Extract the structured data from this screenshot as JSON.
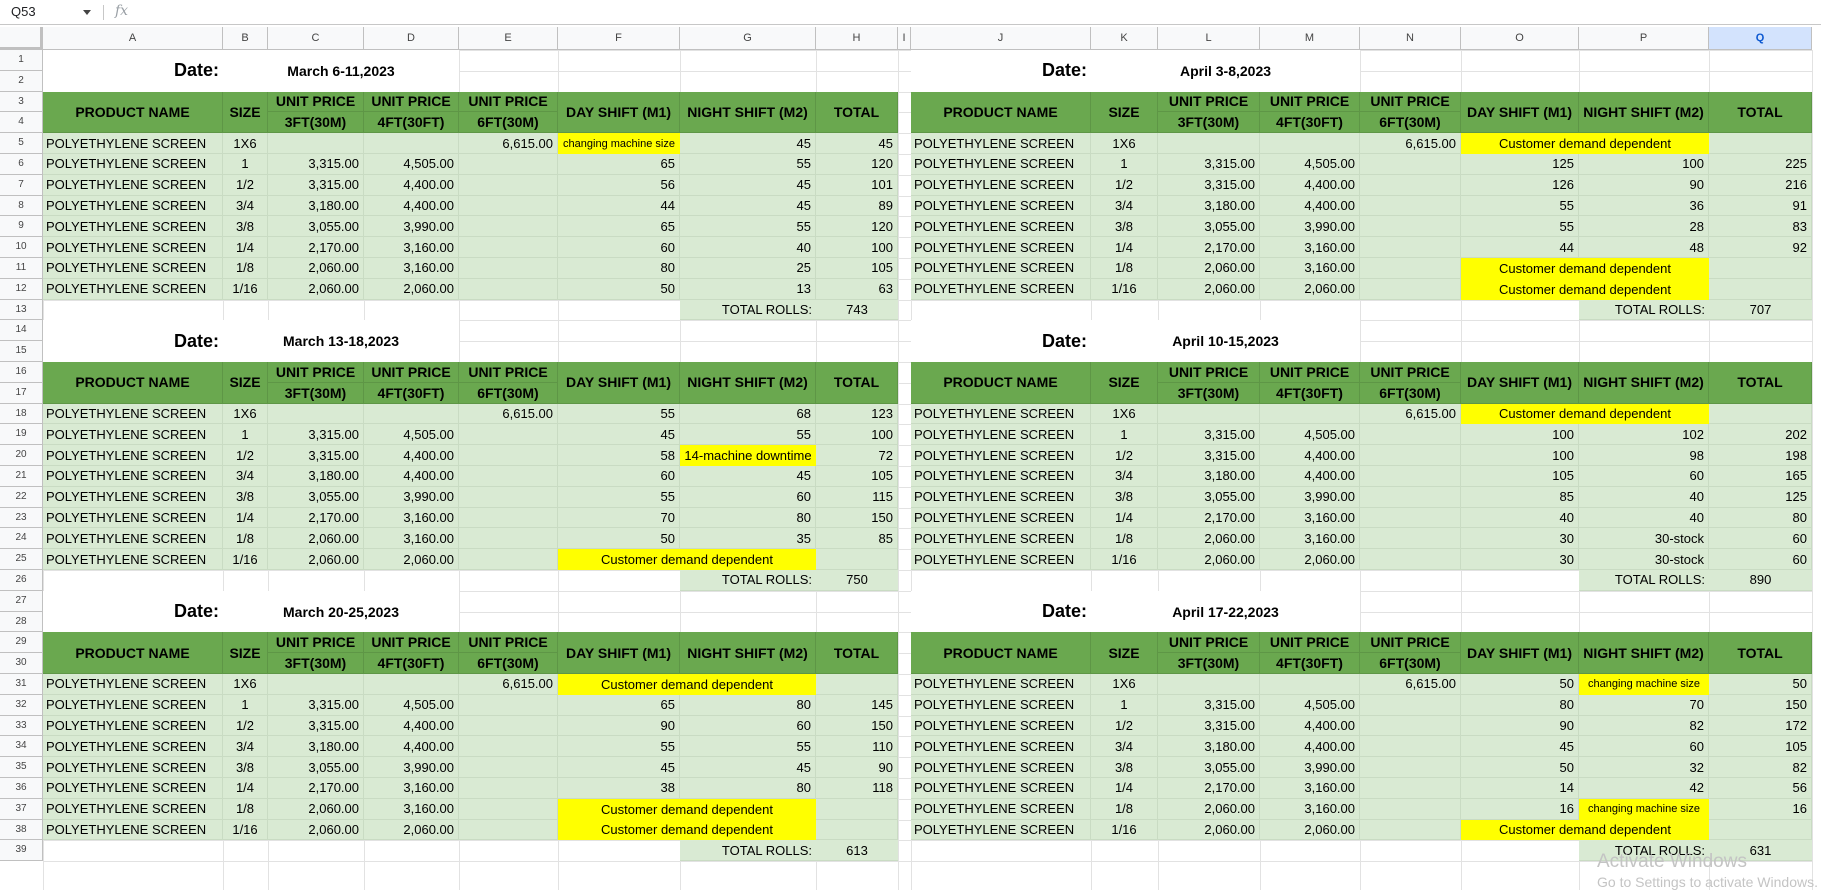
{
  "formula_bar": {
    "name_box": "Q53",
    "fx": "fx"
  },
  "columns": [
    "A",
    "B",
    "C",
    "D",
    "E",
    "F",
    "G",
    "H",
    "I",
    "J",
    "K",
    "L",
    "M",
    "N",
    "O",
    "P",
    "Q"
  ],
  "selected_column": "Q",
  "rows": [
    "1",
    "2",
    "3",
    "4",
    "5",
    "6",
    "7",
    "8",
    "9",
    "10",
    "11",
    "12",
    "13",
    "14",
    "15",
    "16",
    "17",
    "18",
    "19",
    "20",
    "21",
    "22",
    "23",
    "24",
    "25",
    "26",
    "27",
    "28",
    "29",
    "30",
    "31",
    "32",
    "33",
    "34",
    "35",
    "36",
    "37",
    "38",
    "39"
  ],
  "headers": {
    "product": "PRODUCT NAME",
    "size": "SIZE",
    "up": "UNIT PRICE",
    "p3": "3FT(30M)",
    "p4": "4FT(30FT)",
    "p6": "6FT(30M)",
    "day": "DAY SHIFT (M1)",
    "night": "NIGHT SHIFT (M2)",
    "total": "TOTAL"
  },
  "date_label": "Date:",
  "total_rolls_label": "TOTAL ROLLS:",
  "blocks": [
    {
      "date": "March 6-11,2023",
      "total_rolls": "743",
      "rows": [
        [
          "POLYETHYLENE SCREEN",
          "1X6",
          "",
          "",
          "6,615.00",
          "changing machine size",
          "45",
          "45"
        ],
        [
          "POLYETHYLENE SCREEN",
          "1",
          "3,315.00",
          "4,505.00",
          "",
          "65",
          "55",
          "120"
        ],
        [
          "POLYETHYLENE SCREEN",
          "1/2",
          "3,315.00",
          "4,400.00",
          "",
          "56",
          "45",
          "101"
        ],
        [
          "POLYETHYLENE SCREEN",
          "3/4",
          "3,180.00",
          "4,400.00",
          "",
          "44",
          "45",
          "89"
        ],
        [
          "POLYETHYLENE SCREEN",
          "3/8",
          "3,055.00",
          "3,990.00",
          "",
          "65",
          "55",
          "120"
        ],
        [
          "POLYETHYLENE SCREEN",
          "1/4",
          "2,170.00",
          "3,160.00",
          "",
          "60",
          "40",
          "100"
        ],
        [
          "POLYETHYLENE SCREEN",
          "1/8",
          "2,060.00",
          "3,160.00",
          "",
          "80",
          "25",
          "105"
        ],
        [
          "POLYETHYLENE SCREEN",
          "1/16",
          "2,060.00",
          "2,060.00",
          "",
          "50",
          "13",
          "63"
        ]
      ]
    },
    {
      "date": "March 13-18,2023",
      "total_rolls": "750",
      "rows": [
        [
          "POLYETHYLENE SCREEN",
          "1X6",
          "",
          "",
          "6,615.00",
          "55",
          "68",
          "123"
        ],
        [
          "POLYETHYLENE SCREEN",
          "1",
          "3,315.00",
          "4,505.00",
          "",
          "45",
          "55",
          "100"
        ],
        [
          "POLYETHYLENE SCREEN",
          "1/2",
          "3,315.00",
          "4,400.00",
          "",
          "58",
          "14-machine downtime",
          "72"
        ],
        [
          "POLYETHYLENE SCREEN",
          "3/4",
          "3,180.00",
          "4,400.00",
          "",
          "60",
          "45",
          "105"
        ],
        [
          "POLYETHYLENE SCREEN",
          "3/8",
          "3,055.00",
          "3,990.00",
          "",
          "55",
          "60",
          "115"
        ],
        [
          "POLYETHYLENE SCREEN",
          "1/4",
          "2,170.00",
          "3,160.00",
          "",
          "70",
          "80",
          "150"
        ],
        [
          "POLYETHYLENE SCREEN",
          "1/8",
          "2,060.00",
          "3,160.00",
          "",
          "50",
          "35",
          "85"
        ],
        [
          "POLYETHYLENE SCREEN",
          "1/16",
          "2,060.00",
          "2,060.00",
          "",
          "Customer demand dependent",
          "",
          ""
        ]
      ]
    },
    {
      "date": "March 20-25,2023",
      "total_rolls": "613",
      "rows": [
        [
          "POLYETHYLENE SCREEN",
          "1X6",
          "",
          "",
          "6,615.00",
          "Customer demand dependent",
          "",
          ""
        ],
        [
          "POLYETHYLENE SCREEN",
          "1",
          "3,315.00",
          "4,505.00",
          "",
          "65",
          "80",
          "145"
        ],
        [
          "POLYETHYLENE SCREEN",
          "1/2",
          "3,315.00",
          "4,400.00",
          "",
          "90",
          "60",
          "150"
        ],
        [
          "POLYETHYLENE SCREEN",
          "3/4",
          "3,180.00",
          "4,400.00",
          "",
          "55",
          "55",
          "110"
        ],
        [
          "POLYETHYLENE SCREEN",
          "3/8",
          "3,055.00",
          "3,990.00",
          "",
          "45",
          "45",
          "90"
        ],
        [
          "POLYETHYLENE SCREEN",
          "1/4",
          "2,170.00",
          "3,160.00",
          "",
          "38",
          "80",
          "118"
        ],
        [
          "POLYETHYLENE SCREEN",
          "1/8",
          "2,060.00",
          "3,160.00",
          "",
          "Customer demand dependent",
          "",
          ""
        ],
        [
          "POLYETHYLENE SCREEN",
          "1/16",
          "2,060.00",
          "2,060.00",
          "",
          "Customer demand dependent",
          "",
          ""
        ]
      ]
    },
    {
      "date": "April 3-8,2023",
      "total_rolls": "707",
      "rows": [
        [
          "POLYETHYLENE SCREEN",
          "1X6",
          "",
          "",
          "6,615.00",
          "Customer demand dependent",
          "",
          ""
        ],
        [
          "POLYETHYLENE SCREEN",
          "1",
          "3,315.00",
          "4,505.00",
          "",
          "125",
          "100",
          "225"
        ],
        [
          "POLYETHYLENE SCREEN",
          "1/2",
          "3,315.00",
          "4,400.00",
          "",
          "126",
          "90",
          "216"
        ],
        [
          "POLYETHYLENE SCREEN",
          "3/4",
          "3,180.00",
          "4,400.00",
          "",
          "55",
          "36",
          "91"
        ],
        [
          "POLYETHYLENE SCREEN",
          "3/8",
          "3,055.00",
          "3,990.00",
          "",
          "55",
          "28",
          "83"
        ],
        [
          "POLYETHYLENE SCREEN",
          "1/4",
          "2,170.00",
          "3,160.00",
          "",
          "44",
          "48",
          "92"
        ],
        [
          "POLYETHYLENE SCREEN",
          "1/8",
          "2,060.00",
          "3,160.00",
          "",
          "Customer demand dependent",
          "",
          ""
        ],
        [
          "POLYETHYLENE SCREEN",
          "1/16",
          "2,060.00",
          "2,060.00",
          "",
          "Customer demand dependent",
          "",
          ""
        ]
      ]
    },
    {
      "date": "April 10-15,2023",
      "total_rolls": "890",
      "rows": [
        [
          "POLYETHYLENE SCREEN",
          "1X6",
          "",
          "",
          "6,615.00",
          "Customer demand dependent",
          "",
          ""
        ],
        [
          "POLYETHYLENE SCREEN",
          "1",
          "3,315.00",
          "4,505.00",
          "",
          "100",
          "102",
          "202"
        ],
        [
          "POLYETHYLENE SCREEN",
          "1/2",
          "3,315.00",
          "4,400.00",
          "",
          "100",
          "98",
          "198"
        ],
        [
          "POLYETHYLENE SCREEN",
          "3/4",
          "3,180.00",
          "4,400.00",
          "",
          "105",
          "60",
          "165"
        ],
        [
          "POLYETHYLENE SCREEN",
          "3/8",
          "3,055.00",
          "3,990.00",
          "",
          "85",
          "40",
          "125"
        ],
        [
          "POLYETHYLENE SCREEN",
          "1/4",
          "2,170.00",
          "3,160.00",
          "",
          "40",
          "40",
          "80"
        ],
        [
          "POLYETHYLENE SCREEN",
          "1/8",
          "2,060.00",
          "3,160.00",
          "",
          "30",
          "30-stock",
          "60"
        ],
        [
          "POLYETHYLENE SCREEN",
          "1/16",
          "2,060.00",
          "2,060.00",
          "",
          "30",
          "30-stock",
          "60"
        ]
      ]
    },
    {
      "date": "April 17-22,2023",
      "total_rolls": "631",
      "rows": [
        [
          "POLYETHYLENE SCREEN",
          "1X6",
          "",
          "",
          "6,615.00",
          "50",
          "changing machine size",
          "50"
        ],
        [
          "POLYETHYLENE SCREEN",
          "1",
          "3,315.00",
          "4,505.00",
          "",
          "80",
          "70",
          "150"
        ],
        [
          "POLYETHYLENE SCREEN",
          "1/2",
          "3,315.00",
          "4,400.00",
          "",
          "90",
          "82",
          "172"
        ],
        [
          "POLYETHYLENE SCREEN",
          "3/4",
          "3,180.00",
          "4,400.00",
          "",
          "45",
          "60",
          "105"
        ],
        [
          "POLYETHYLENE SCREEN",
          "3/8",
          "3,055.00",
          "3,990.00",
          "",
          "50",
          "32",
          "82"
        ],
        [
          "POLYETHYLENE SCREEN",
          "1/4",
          "2,170.00",
          "3,160.00",
          "",
          "14",
          "42",
          "56"
        ],
        [
          "POLYETHYLENE SCREEN",
          "1/8",
          "2,060.00",
          "3,160.00",
          "",
          "16",
          "changing machine size",
          "16"
        ],
        [
          "POLYETHYLENE SCREEN",
          "1/16",
          "2,060.00",
          "2,060.00",
          "",
          "Customer demand dependent",
          "",
          ""
        ]
      ]
    }
  ],
  "watermark": {
    "line1": "Activate Windows",
    "line2": "Go to Settings to activate Windows."
  },
  "colors": {
    "header_green": "#6aa84f",
    "row_green": "#d9ead3",
    "highlight_yellow": "#ffff00"
  }
}
